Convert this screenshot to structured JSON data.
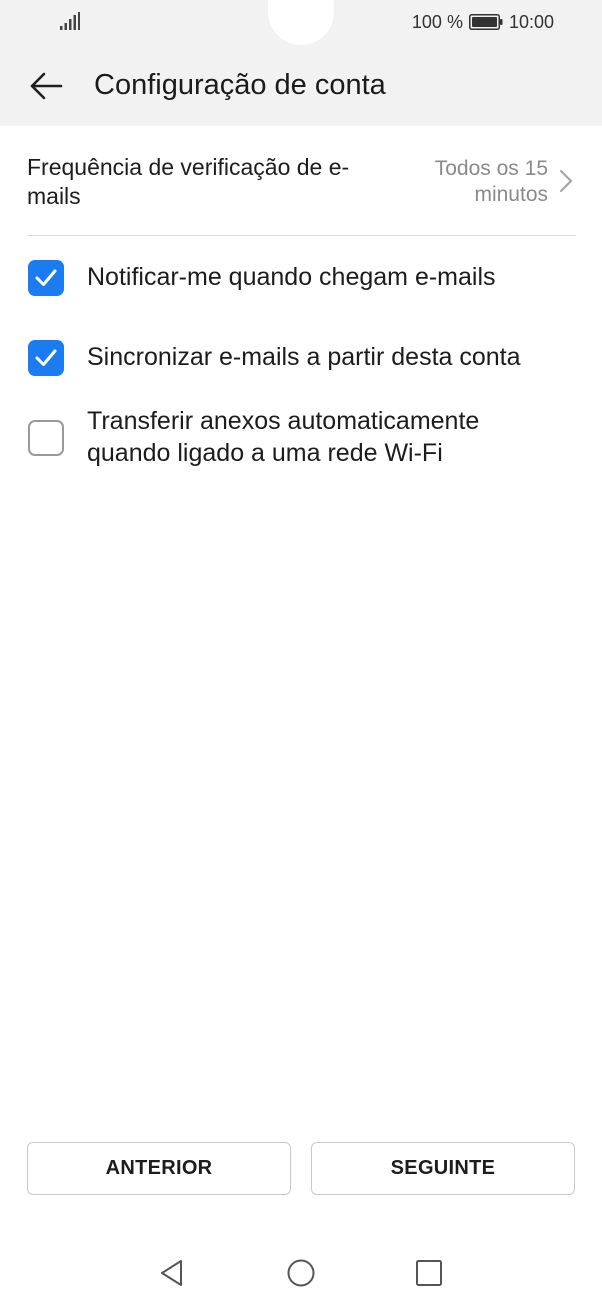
{
  "status_bar": {
    "battery_text": "100 %",
    "time": "10:00",
    "icons": [
      "signal-icon",
      "battery-icon"
    ]
  },
  "header": {
    "title": "Configuração de conta",
    "back_icon": "back-arrow-icon"
  },
  "frequency": {
    "label": "Frequência de verificação de e-mails",
    "value": "Todos os 15 minutos",
    "chevron_icon": "chevron-right-icon"
  },
  "options": [
    {
      "label": "Notificar-me quando chegam e-mails",
      "checked": true
    },
    {
      "label": "Sincronizar e-mails a partir desta conta",
      "checked": true
    },
    {
      "label": "Transferir anexos automaticamente quando ligado a uma rede Wi-Fi",
      "checked": false
    }
  ],
  "buttons": {
    "previous": "ANTERIOR",
    "next": "SEGUINTE"
  },
  "nav_bar": {
    "icons": [
      "nav-back-icon",
      "nav-home-icon",
      "nav-recents-icon"
    ]
  },
  "colors": {
    "accent": "#1a7cf0",
    "header_bg": "#f2f2f2",
    "secondary_text": "#8a8a8a"
  }
}
